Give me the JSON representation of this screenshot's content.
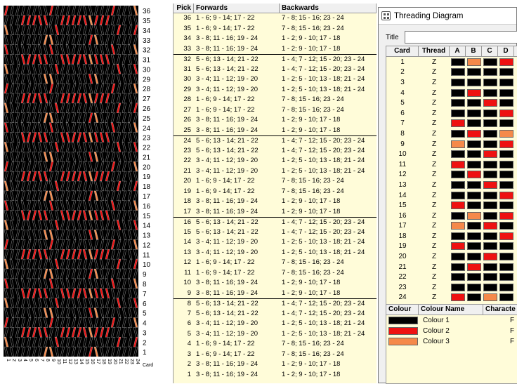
{
  "weave": {
    "pick_labels": [
      "36",
      "35",
      "34",
      "33",
      "32",
      "31",
      "30",
      "29",
      "28",
      "27",
      "26",
      "25",
      "24",
      "23",
      "22",
      "21",
      "20",
      "19",
      "18",
      "17",
      "16",
      "15",
      "14",
      "13",
      "12",
      "11",
      "10",
      "9",
      "8",
      "7",
      "6",
      "5",
      "4",
      "3",
      "2",
      "1"
    ],
    "card_labels": [
      "1",
      "2",
      "3",
      "4",
      "5",
      "6",
      "7",
      "8",
      "9",
      "10",
      "11",
      "12",
      "13",
      "14",
      "15",
      "16",
      "17",
      "18",
      "19",
      "20",
      "21",
      "22",
      "23",
      "24"
    ],
    "corner_label": "Card"
  },
  "pick_table": {
    "headers": {
      "pick": "Pick",
      "forwards": "Forwards",
      "backwards": "Backwards"
    },
    "rows": [
      {
        "pick": "36",
        "fw": "1 - 6; 9 - 14; 17 - 22",
        "bw": "7 - 8; 15 - 16; 23 - 24"
      },
      {
        "pick": "35",
        "fw": "1 - 6; 9 - 14; 17 - 22",
        "bw": "7 - 8; 15 - 16; 23 - 24"
      },
      {
        "pick": "34",
        "fw": "3 - 8; 11 - 16; 19 - 24",
        "bw": "1 - 2; 9 - 10; 17 - 18"
      },
      {
        "pick": "33",
        "fw": "3 - 8; 11 - 16; 19 - 24",
        "bw": "1 - 2; 9 - 10; 17 - 18"
      },
      {
        "pick": "32",
        "fw": "5 - 6; 13 - 14; 21 - 22",
        "bw": "1 - 4; 7 - 12; 15 - 20; 23 - 24"
      },
      {
        "pick": "31",
        "fw": "5 - 6; 13 - 14; 21 - 22",
        "bw": "1 - 4; 7 - 12; 15 - 20; 23 - 24"
      },
      {
        "pick": "30",
        "fw": "3 - 4; 11 - 12; 19 - 20",
        "bw": "1 - 2; 5 - 10; 13 - 18; 21 - 24"
      },
      {
        "pick": "29",
        "fw": "3 - 4; 11 - 12; 19 - 20",
        "bw": "1 - 2; 5 - 10; 13 - 18; 21 - 24"
      },
      {
        "pick": "28",
        "fw": "1 - 6; 9 - 14; 17 - 22",
        "bw": "7 - 8; 15 - 16; 23 - 24"
      },
      {
        "pick": "27",
        "fw": "1 - 6; 9 - 14; 17 - 22",
        "bw": "7 - 8; 15 - 16; 23 - 24"
      },
      {
        "pick": "26",
        "fw": "3 - 8; 11 - 16; 19 - 24",
        "bw": "1 - 2; 9 - 10; 17 - 18"
      },
      {
        "pick": "25",
        "fw": "3 - 8; 11 - 16; 19 - 24",
        "bw": "1 - 2; 9 - 10; 17 - 18"
      },
      {
        "pick": "24",
        "fw": "5 - 6; 13 - 14; 21 - 22",
        "bw": "1 - 4; 7 - 12; 15 - 20; 23 - 24"
      },
      {
        "pick": "23",
        "fw": "5 - 6; 13 - 14; 21 - 22",
        "bw": "1 - 4; 7 - 12; 15 - 20; 23 - 24"
      },
      {
        "pick": "22",
        "fw": "3 - 4; 11 - 12; 19 - 20",
        "bw": "1 - 2; 5 - 10; 13 - 18; 21 - 24"
      },
      {
        "pick": "21",
        "fw": "3 - 4; 11 - 12; 19 - 20",
        "bw": "1 - 2; 5 - 10; 13 - 18; 21 - 24"
      },
      {
        "pick": "20",
        "fw": "1 - 6; 9 - 14; 17 - 22",
        "bw": "7 - 8; 15 - 16; 23 - 24"
      },
      {
        "pick": "19",
        "fw": "1 - 6; 9 - 14; 17 - 22",
        "bw": "7 - 8; 15 - 16; 23 - 24"
      },
      {
        "pick": "18",
        "fw": "3 - 8; 11 - 16; 19 - 24",
        "bw": "1 - 2; 9 - 10; 17 - 18"
      },
      {
        "pick": "17",
        "fw": "3 - 8; 11 - 16; 19 - 24",
        "bw": "1 - 2; 9 - 10; 17 - 18"
      },
      {
        "pick": "16",
        "fw": "5 - 6; 13 - 14; 21 - 22",
        "bw": "1 - 4; 7 - 12; 15 - 20; 23 - 24"
      },
      {
        "pick": "15",
        "fw": "5 - 6; 13 - 14; 21 - 22",
        "bw": "1 - 4; 7 - 12; 15 - 20; 23 - 24"
      },
      {
        "pick": "14",
        "fw": "3 - 4; 11 - 12; 19 - 20",
        "bw": "1 - 2; 5 - 10; 13 - 18; 21 - 24"
      },
      {
        "pick": "13",
        "fw": "3 - 4; 11 - 12; 19 - 20",
        "bw": "1 - 2; 5 - 10; 13 - 18; 21 - 24"
      },
      {
        "pick": "12",
        "fw": "1 - 6; 9 - 14; 17 - 22",
        "bw": "7 - 8; 15 - 16; 23 - 24"
      },
      {
        "pick": "11",
        "fw": "1 - 6; 9 - 14; 17 - 22",
        "bw": "7 - 8; 15 - 16; 23 - 24"
      },
      {
        "pick": "10",
        "fw": "3 - 8; 11 - 16; 19 - 24",
        "bw": "1 - 2; 9 - 10; 17 - 18"
      },
      {
        "pick": "9",
        "fw": "3 - 8; 11 - 16; 19 - 24",
        "bw": "1 - 2; 9 - 10; 17 - 18"
      },
      {
        "pick": "8",
        "fw": "5 - 6; 13 - 14; 21 - 22",
        "bw": "1 - 4; 7 - 12; 15 - 20; 23 - 24"
      },
      {
        "pick": "7",
        "fw": "5 - 6; 13 - 14; 21 - 22",
        "bw": "1 - 4; 7 - 12; 15 - 20; 23 - 24"
      },
      {
        "pick": "6",
        "fw": "3 - 4; 11 - 12; 19 - 20",
        "bw": "1 - 2; 5 - 10; 13 - 18; 21 - 24"
      },
      {
        "pick": "5",
        "fw": "3 - 4; 11 - 12; 19 - 20",
        "bw": "1 - 2; 5 - 10; 13 - 18; 21 - 24"
      },
      {
        "pick": "4",
        "fw": "1 - 6; 9 - 14; 17 - 22",
        "bw": "7 - 8; 15 - 16; 23 - 24"
      },
      {
        "pick": "3",
        "fw": "1 - 6; 9 - 14; 17 - 22",
        "bw": "7 - 8; 15 - 16; 23 - 24"
      },
      {
        "pick": "2",
        "fw": "3 - 8; 11 - 16; 19 - 24",
        "bw": "1 - 2; 9 - 10; 17 - 18"
      },
      {
        "pick": "1",
        "fw": "3 - 8; 11 - 16; 19 - 24",
        "bw": "1 - 2; 9 - 10; 17 - 18"
      }
    ]
  },
  "threading": {
    "window_title": "Threading Diagram",
    "title_label": "Title",
    "title_value": "",
    "headers": {
      "card": "Card",
      "thread": "Thread",
      "a": "A",
      "b": "B",
      "c": "C",
      "d": "D"
    },
    "colors": {
      "1": "#000000",
      "2": "#ee1111",
      "3": "#f5894a"
    },
    "cards": [
      {
        "card": "1",
        "thread": "Z",
        "holes": [
          1,
          3,
          1,
          2
        ]
      },
      {
        "card": "2",
        "thread": "Z",
        "holes": [
          1,
          1,
          1,
          1
        ]
      },
      {
        "card": "3",
        "thread": "Z",
        "holes": [
          1,
          1,
          1,
          1
        ]
      },
      {
        "card": "4",
        "thread": "Z",
        "holes": [
          1,
          2,
          1,
          1
        ]
      },
      {
        "card": "5",
        "thread": "Z",
        "holes": [
          1,
          1,
          2,
          1
        ]
      },
      {
        "card": "6",
        "thread": "Z",
        "holes": [
          1,
          1,
          1,
          2
        ]
      },
      {
        "card": "7",
        "thread": "Z",
        "holes": [
          2,
          1,
          1,
          1
        ]
      },
      {
        "card": "8",
        "thread": "Z",
        "holes": [
          1,
          2,
          1,
          3
        ]
      },
      {
        "card": "9",
        "thread": "Z",
        "holes": [
          3,
          1,
          1,
          2
        ]
      },
      {
        "card": "10",
        "thread": "Z",
        "holes": [
          1,
          1,
          2,
          1
        ]
      },
      {
        "card": "11",
        "thread": "Z",
        "holes": [
          2,
          1,
          1,
          1
        ]
      },
      {
        "card": "12",
        "thread": "Z",
        "holes": [
          1,
          2,
          1,
          1
        ]
      },
      {
        "card": "13",
        "thread": "Z",
        "holes": [
          1,
          1,
          2,
          1
        ]
      },
      {
        "card": "14",
        "thread": "Z",
        "holes": [
          1,
          1,
          1,
          2
        ]
      },
      {
        "card": "15",
        "thread": "Z",
        "holes": [
          2,
          1,
          1,
          1
        ]
      },
      {
        "card": "16",
        "thread": "Z",
        "holes": [
          1,
          3,
          1,
          2
        ]
      },
      {
        "card": "17",
        "thread": "Z",
        "holes": [
          3,
          1,
          2,
          1
        ]
      },
      {
        "card": "18",
        "thread": "Z",
        "holes": [
          1,
          1,
          1,
          2
        ]
      },
      {
        "card": "19",
        "thread": "Z",
        "holes": [
          2,
          1,
          1,
          1
        ]
      },
      {
        "card": "20",
        "thread": "Z",
        "holes": [
          1,
          1,
          2,
          1
        ]
      },
      {
        "card": "21",
        "thread": "Z",
        "holes": [
          1,
          2,
          1,
          1
        ]
      },
      {
        "card": "22",
        "thread": "Z",
        "holes": [
          1,
          1,
          1,
          1
        ]
      },
      {
        "card": "23",
        "thread": "Z",
        "holes": [
          1,
          1,
          1,
          1
        ]
      },
      {
        "card": "24",
        "thread": "Z",
        "holes": [
          2,
          1,
          3,
          1
        ]
      }
    ]
  },
  "colour_table": {
    "headers": {
      "colour": "Colour",
      "name": "Colour Name",
      "character": "Characte"
    },
    "rows": [
      {
        "color": "#000000",
        "name": "Colour 1",
        "char": "F"
      },
      {
        "color": "#ee1111",
        "name": "Colour 2",
        "char": "F"
      },
      {
        "color": "#f5894a",
        "name": "Colour 3",
        "char": "F"
      }
    ]
  }
}
